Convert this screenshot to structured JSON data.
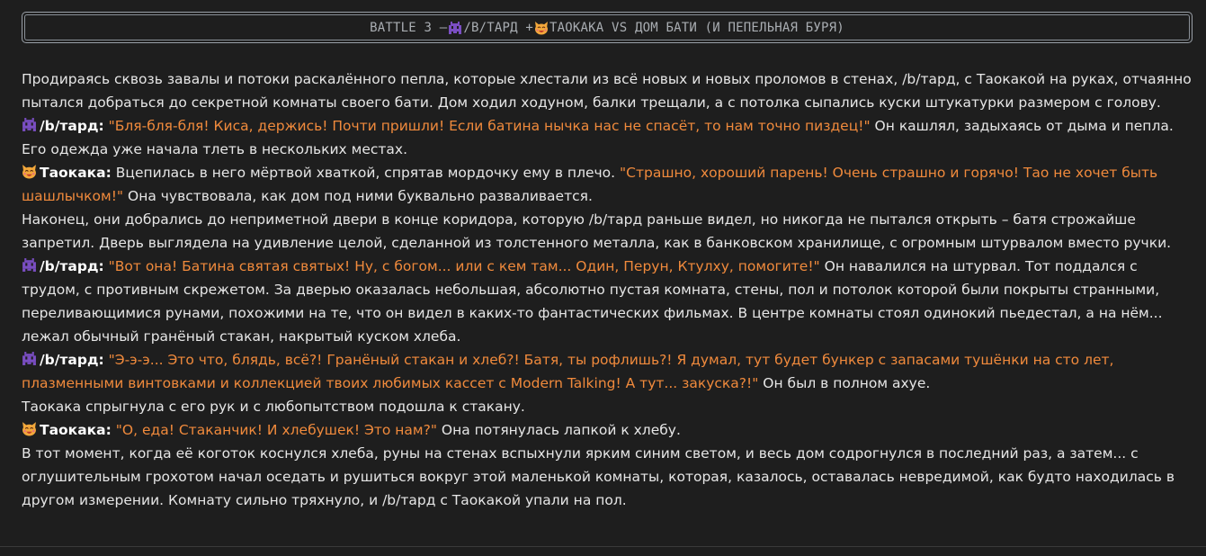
{
  "header": {
    "prefix": "BATTLE 3 – ",
    "bartard": "/B/ТАРД + ",
    "suffix": "ТАОКАКА VS ДОМ БАТИ (И ПЕПЕЛЬНАЯ БУРЯ)"
  },
  "story": {
    "p1": "Продираясь сквозь завалы и потоки раскалённого пепла, которые хлестали из всё новых и новых проломов в стенах, /b/тард, с Таокакой на руках, отчаянно пытался добраться до секретной комнаты своего бати. Дом ходил ходуном, балки трещали, а с потолка сыпались куски штукатурки размером с голову.",
    "l2_speaker": "/b/тард:",
    "l2_quote": "\"Бля-бля-бля! Киса, держись! Почти пришли! Если батина нычка нас не спасёт, то нам точно пиздец!\"",
    "l2_rest": " Он кашлял, задыхаясь от дыма и пепла. Его одежда уже начала тлеть в нескольких местах.",
    "l3_speaker": "Таокака:",
    "l3_pre": " Вцепилась в него мёртвой хваткой, спрятав мордочку ему в плечо. ",
    "l3_quote": "\"Страшно, хороший парень! Очень страшно и горячо! Тао не хочет быть шашлычком!\"",
    "l3_rest": " Она чувствовала, как дом под ними буквально разваливается.",
    "p4": "Наконец, они добрались до неприметной двери в конце коридора, которую /b/тард раньше видел, но никогда не пытался открыть – батя строжайше запретил. Дверь выглядела на удивление целой, сделанной из толстенного металла, как в банковском хранилище, с огромным штурвалом вместо ручки.",
    "l5_speaker": "/b/тард:",
    "l5_quote": "\"Вот она! Батина святая святых! Ну, с богом... или с кем там... Один, Перун, Ктулху, помогите!\"",
    "l5_rest": " Он навалился на штурвал. Тот поддался с трудом, с противным скрежетом. За дверью оказалась небольшая, абсолютно пустая комната, стены, пол и потолок которой были покрыты странными, переливающимися рунами, похожими на те, что он видел в каких-то фантастических фильмах. В центре комнаты стоял одинокий пьедестал, а на нём... лежал обычный гранёный стакан, накрытый куском хлеба.",
    "l6_speaker": "/b/тард:",
    "l6_quote": "\"Э-э-э... Это что, блядь, всё?! Гранёный стакан и хлеб?! Батя, ты рофлишь?! Я думал, тут будет бункер с запасами тушёнки на сто лет, плазменными винтовками и коллекцией твоих любимых кассет с Modern Talking! А тут... закуска?!\"",
    "l6_rest": " Он был в полном ахуе.",
    "p7": "Таокака спрыгнула с его рук и с любопытством подошла к стакану.",
    "l8_speaker": "Таокака:",
    "l8_quote": "\"О, еда! Стаканчик! И хлебушек! Это нам?\"",
    "l8_rest": " Она потянулась лапкой к хлебу.",
    "p9": "В тот момент, когда её коготок коснулся хлеба, руны на стенах вспыхнули ярким синим светом, и весь дом содрогнулся в последний раз, а затем... с оглушительным грохотом начал оседать и рушиться вокруг этой маленькой комнаты, которая, казалось, оставалась невредимой, как будто находилась в другом измерении. Комнату сильно тряхнуло, и /b/тард с Таокакой упали на пол."
  },
  "icons": {
    "bartard": "alien-monster-icon",
    "taokaka": "cat-face-icon"
  },
  "colors": {
    "background": "#1e1e1e",
    "quote": "#f08a3c",
    "text": "#e6e6e6"
  }
}
